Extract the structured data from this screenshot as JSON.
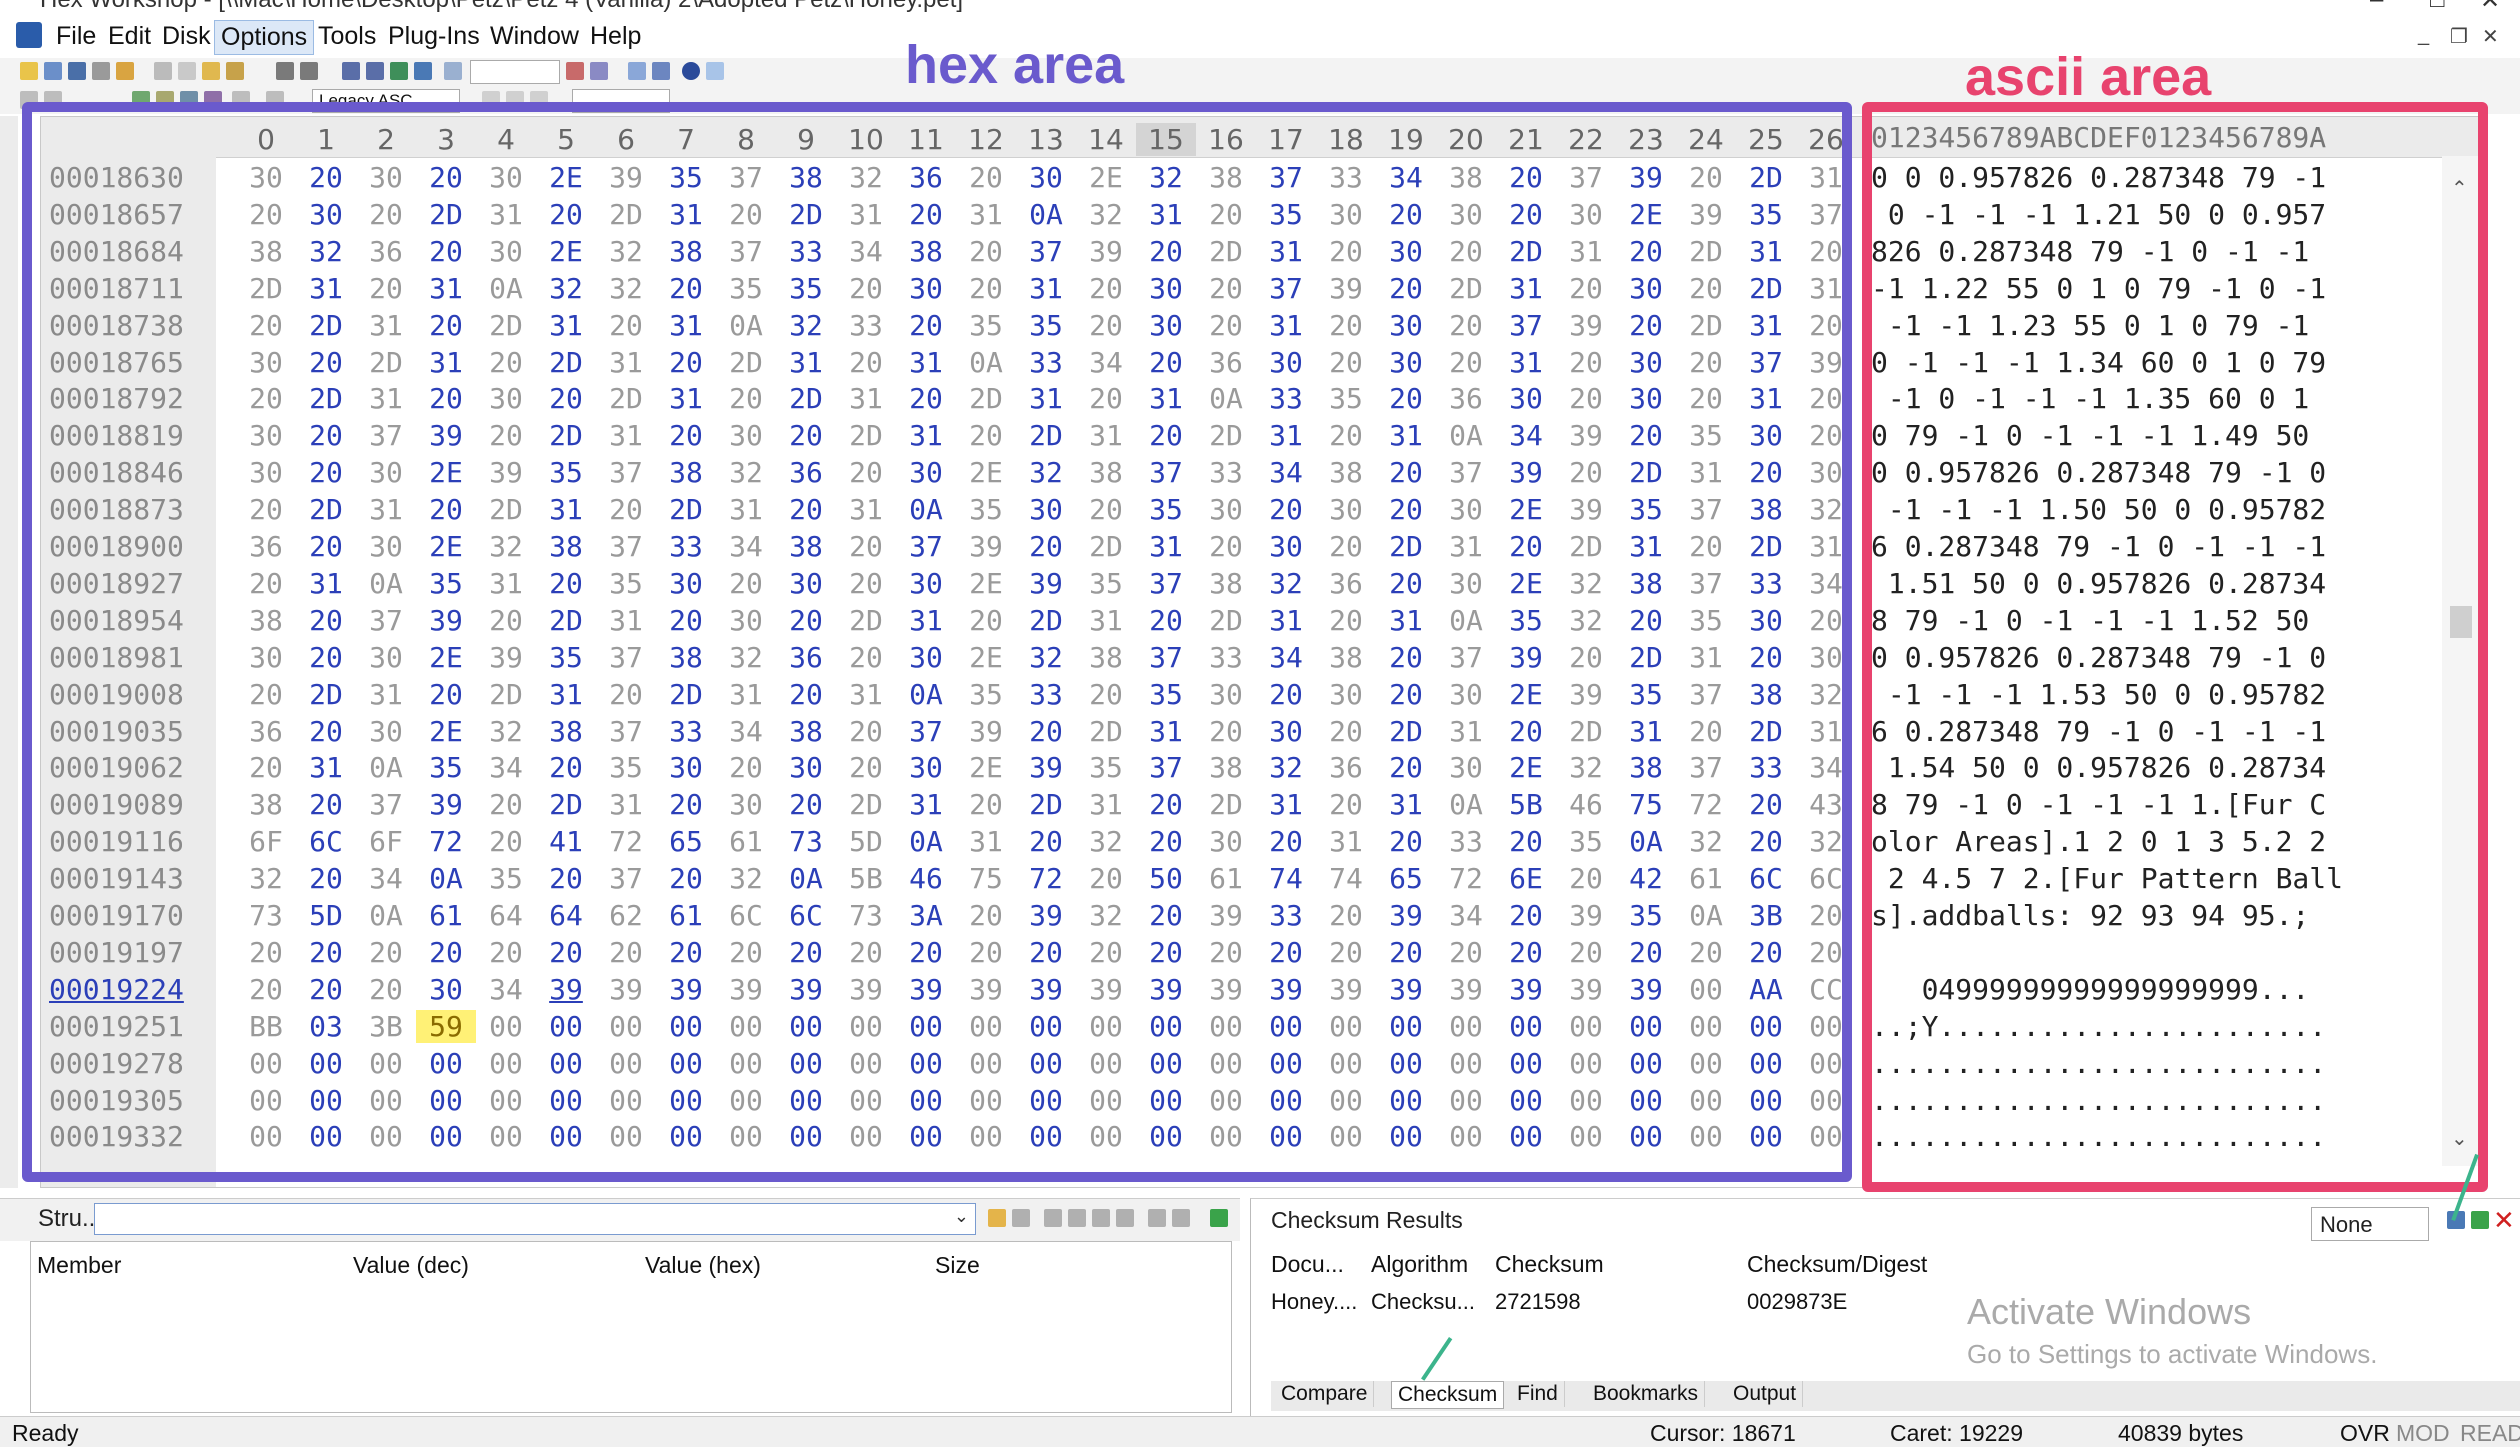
{
  "window": {
    "title": "Hex Workshop - [\\\\Mac\\Home\\Desktop\\Petz\\Petz 4 (Vanilla) 2\\Adopted Petz\\Honey.pet]"
  },
  "menu": [
    "File",
    "Edit",
    "Disk",
    "Options",
    "Tools",
    "Plug-Ins",
    "Window",
    "Help"
  ],
  "toolbar": {
    "view_select": "Legacy ASC"
  },
  "annotations": {
    "hex_label": "hex area",
    "ascii_label": "ascii area"
  },
  "editor": {
    "columns": [
      "0",
      "1",
      "2",
      "3",
      "4",
      "5",
      "6",
      "7",
      "8",
      "9",
      "10",
      "11",
      "12",
      "13",
      "14",
      "15",
      "16",
      "17",
      "18",
      "19",
      "20",
      "21",
      "22",
      "23",
      "24",
      "25",
      "26"
    ],
    "ascii_header": "0123456789ABCDEF0123456789A",
    "rows": [
      {
        "addr": "00018630",
        "hex": [
          "30",
          "20",
          "30",
          "20",
          "30",
          "2E",
          "39",
          "35",
          "37",
          "38",
          "32",
          "36",
          "20",
          "30",
          "2E",
          "32",
          "38",
          "37",
          "33",
          "34",
          "38",
          "20",
          "37",
          "39",
          "20",
          "2D",
          "31"
        ],
        "ascii": "0 0 0.957826 0.287348 79 -1"
      },
      {
        "addr": "00018657",
        "hex": [
          "20",
          "30",
          "20",
          "2D",
          "31",
          "20",
          "2D",
          "31",
          "20",
          "2D",
          "31",
          "20",
          "31",
          "0A",
          "32",
          "31",
          "20",
          "35",
          "30",
          "20",
          "30",
          "20",
          "30",
          "2E",
          "39",
          "35",
          "37"
        ],
        "ascii": " 0 -1 -1 -1 1.21 50 0 0.957"
      },
      {
        "addr": "00018684",
        "hex": [
          "38",
          "32",
          "36",
          "20",
          "30",
          "2E",
          "32",
          "38",
          "37",
          "33",
          "34",
          "38",
          "20",
          "37",
          "39",
          "20",
          "2D",
          "31",
          "20",
          "30",
          "20",
          "2D",
          "31",
          "20",
          "2D",
          "31",
          "20"
        ],
        "ascii": "826 0.287348 79 -1 0 -1 -1 "
      },
      {
        "addr": "00018711",
        "hex": [
          "2D",
          "31",
          "20",
          "31",
          "0A",
          "32",
          "32",
          "20",
          "35",
          "35",
          "20",
          "30",
          "20",
          "31",
          "20",
          "30",
          "20",
          "37",
          "39",
          "20",
          "2D",
          "31",
          "20",
          "30",
          "20",
          "2D",
          "31"
        ],
        "ascii": "-1 1.22 55 0 1 0 79 -1 0 -1"
      },
      {
        "addr": "00018738",
        "hex": [
          "20",
          "2D",
          "31",
          "20",
          "2D",
          "31",
          "20",
          "31",
          "0A",
          "32",
          "33",
          "20",
          "35",
          "35",
          "20",
          "30",
          "20",
          "31",
          "20",
          "30",
          "20",
          "37",
          "39",
          "20",
          "2D",
          "31",
          "20"
        ],
        "ascii": " -1 -1 1.23 55 0 1 0 79 -1 "
      },
      {
        "addr": "00018765",
        "hex": [
          "30",
          "20",
          "2D",
          "31",
          "20",
          "2D",
          "31",
          "20",
          "2D",
          "31",
          "20",
          "31",
          "0A",
          "33",
          "34",
          "20",
          "36",
          "30",
          "20",
          "30",
          "20",
          "31",
          "20",
          "30",
          "20",
          "37",
          "39"
        ],
        "ascii": "0 -1 -1 -1 1.34 60 0 1 0 79"
      },
      {
        "addr": "00018792",
        "hex": [
          "20",
          "2D",
          "31",
          "20",
          "30",
          "20",
          "2D",
          "31",
          "20",
          "2D",
          "31",
          "20",
          "2D",
          "31",
          "20",
          "31",
          "0A",
          "33",
          "35",
          "20",
          "36",
          "30",
          "20",
          "30",
          "20",
          "31",
          "20"
        ],
        "ascii": " -1 0 -1 -1 -1 1.35 60 0 1 "
      },
      {
        "addr": "00018819",
        "hex": [
          "30",
          "20",
          "37",
          "39",
          "20",
          "2D",
          "31",
          "20",
          "30",
          "20",
          "2D",
          "31",
          "20",
          "2D",
          "31",
          "20",
          "2D",
          "31",
          "20",
          "31",
          "0A",
          "34",
          "39",
          "20",
          "35",
          "30",
          "20"
        ],
        "ascii": "0 79 -1 0 -1 -1 -1 1.49 50 "
      },
      {
        "addr": "00018846",
        "hex": [
          "30",
          "20",
          "30",
          "2E",
          "39",
          "35",
          "37",
          "38",
          "32",
          "36",
          "20",
          "30",
          "2E",
          "32",
          "38",
          "37",
          "33",
          "34",
          "38",
          "20",
          "37",
          "39",
          "20",
          "2D",
          "31",
          "20",
          "30"
        ],
        "ascii": "0 0.957826 0.287348 79 -1 0"
      },
      {
        "addr": "00018873",
        "hex": [
          "20",
          "2D",
          "31",
          "20",
          "2D",
          "31",
          "20",
          "2D",
          "31",
          "20",
          "31",
          "0A",
          "35",
          "30",
          "20",
          "35",
          "30",
          "20",
          "30",
          "20",
          "30",
          "2E",
          "39",
          "35",
          "37",
          "38",
          "32"
        ],
        "ascii": " -1 -1 -1 1.50 50 0 0.95782"
      },
      {
        "addr": "00018900",
        "hex": [
          "36",
          "20",
          "30",
          "2E",
          "32",
          "38",
          "37",
          "33",
          "34",
          "38",
          "20",
          "37",
          "39",
          "20",
          "2D",
          "31",
          "20",
          "30",
          "20",
          "2D",
          "31",
          "20",
          "2D",
          "31",
          "20",
          "2D",
          "31"
        ],
        "ascii": "6 0.287348 79 -1 0 -1 -1 -1"
      },
      {
        "addr": "00018927",
        "hex": [
          "20",
          "31",
          "0A",
          "35",
          "31",
          "20",
          "35",
          "30",
          "20",
          "30",
          "20",
          "30",
          "2E",
          "39",
          "35",
          "37",
          "38",
          "32",
          "36",
          "20",
          "30",
          "2E",
          "32",
          "38",
          "37",
          "33",
          "34"
        ],
        "ascii": " 1.51 50 0 0.957826 0.28734"
      },
      {
        "addr": "00018954",
        "hex": [
          "38",
          "20",
          "37",
          "39",
          "20",
          "2D",
          "31",
          "20",
          "30",
          "20",
          "2D",
          "31",
          "20",
          "2D",
          "31",
          "20",
          "2D",
          "31",
          "20",
          "31",
          "0A",
          "35",
          "32",
          "20",
          "35",
          "30",
          "20"
        ],
        "ascii": "8 79 -1 0 -1 -1 -1 1.52 50 "
      },
      {
        "addr": "00018981",
        "hex": [
          "30",
          "20",
          "30",
          "2E",
          "39",
          "35",
          "37",
          "38",
          "32",
          "36",
          "20",
          "30",
          "2E",
          "32",
          "38",
          "37",
          "33",
          "34",
          "38",
          "20",
          "37",
          "39",
          "20",
          "2D",
          "31",
          "20",
          "30"
        ],
        "ascii": "0 0.957826 0.287348 79 -1 0"
      },
      {
        "addr": "00019008",
        "hex": [
          "20",
          "2D",
          "31",
          "20",
          "2D",
          "31",
          "20",
          "2D",
          "31",
          "20",
          "31",
          "0A",
          "35",
          "33",
          "20",
          "35",
          "30",
          "20",
          "30",
          "20",
          "30",
          "2E",
          "39",
          "35",
          "37",
          "38",
          "32"
        ],
        "ascii": " -1 -1 -1 1.53 50 0 0.95782"
      },
      {
        "addr": "00019035",
        "hex": [
          "36",
          "20",
          "30",
          "2E",
          "32",
          "38",
          "37",
          "33",
          "34",
          "38",
          "20",
          "37",
          "39",
          "20",
          "2D",
          "31",
          "20",
          "30",
          "20",
          "2D",
          "31",
          "20",
          "2D",
          "31",
          "20",
          "2D",
          "31"
        ],
        "ascii": "6 0.287348 79 -1 0 -1 -1 -1"
      },
      {
        "addr": "00019062",
        "hex": [
          "20",
          "31",
          "0A",
          "35",
          "34",
          "20",
          "35",
          "30",
          "20",
          "30",
          "20",
          "30",
          "2E",
          "39",
          "35",
          "37",
          "38",
          "32",
          "36",
          "20",
          "30",
          "2E",
          "32",
          "38",
          "37",
          "33",
          "34"
        ],
        "ascii": " 1.54 50 0 0.957826 0.28734"
      },
      {
        "addr": "00019089",
        "hex": [
          "38",
          "20",
          "37",
          "39",
          "20",
          "2D",
          "31",
          "20",
          "30",
          "20",
          "2D",
          "31",
          "20",
          "2D",
          "31",
          "20",
          "2D",
          "31",
          "20",
          "31",
          "0A",
          "5B",
          "46",
          "75",
          "72",
          "20",
          "43"
        ],
        "ascii": "8 79 -1 0 -1 -1 -1 1.[Fur C"
      },
      {
        "addr": "00019116",
        "hex": [
          "6F",
          "6C",
          "6F",
          "72",
          "20",
          "41",
          "72",
          "65",
          "61",
          "73",
          "5D",
          "0A",
          "31",
          "20",
          "32",
          "20",
          "30",
          "20",
          "31",
          "20",
          "33",
          "20",
          "35",
          "0A",
          "32",
          "20",
          "32"
        ],
        "ascii": "olor Areas].1 2 0 1 3 5.2 2"
      },
      {
        "addr": "00019143",
        "hex": [
          "32",
          "20",
          "34",
          "0A",
          "35",
          "20",
          "37",
          "20",
          "32",
          "0A",
          "5B",
          "46",
          "75",
          "72",
          "20",
          "50",
          "61",
          "74",
          "74",
          "65",
          "72",
          "6E",
          "20",
          "42",
          "61",
          "6C",
          "6C"
        ],
        "ascii": " 2 4.5 7 2.[Fur Pattern Ball"
      },
      {
        "addr": "00019170",
        "hex": [
          "73",
          "5D",
          "0A",
          "61",
          "64",
          "64",
          "62",
          "61",
          "6C",
          "6C",
          "73",
          "3A",
          "20",
          "39",
          "32",
          "20",
          "39",
          "33",
          "20",
          "39",
          "34",
          "20",
          "39",
          "35",
          "0A",
          "3B",
          "20"
        ],
        "ascii": "s].addballs: 92 93 94 95.;"
      },
      {
        "addr": "00019197",
        "hex": [
          "20",
          "20",
          "20",
          "20",
          "20",
          "20",
          "20",
          "20",
          "20",
          "20",
          "20",
          "20",
          "20",
          "20",
          "20",
          "20",
          "20",
          "20",
          "20",
          "20",
          "20",
          "20",
          "20",
          "20",
          "20",
          "20",
          "20"
        ],
        "ascii": ""
      },
      {
        "addr": "00019224",
        "hex": [
          "20",
          "20",
          "20",
          "30",
          "34",
          "39",
          "39",
          "39",
          "39",
          "39",
          "39",
          "39",
          "39",
          "39",
          "39",
          "39",
          "39",
          "39",
          "39",
          "39",
          "39",
          "39",
          "39",
          "39",
          "00",
          "AA",
          "CC"
        ],
        "ascii": "   04999999999999999999..."
      },
      {
        "addr": "00019251",
        "hex": [
          "BB",
          "03",
          "3B",
          "59",
          "00",
          "00",
          "00",
          "00",
          "00",
          "00",
          "00",
          "00",
          "00",
          "00",
          "00",
          "00",
          "00",
          "00",
          "00",
          "00",
          "00",
          "00",
          "00",
          "00",
          "00",
          "00",
          "00"
        ],
        "ascii": "..;Y......................."
      },
      {
        "addr": "00019278",
        "hex": [
          "00",
          "00",
          "00",
          "00",
          "00",
          "00",
          "00",
          "00",
          "00",
          "00",
          "00",
          "00",
          "00",
          "00",
          "00",
          "00",
          "00",
          "00",
          "00",
          "00",
          "00",
          "00",
          "00",
          "00",
          "00",
          "00",
          "00"
        ],
        "ascii": "..........................."
      },
      {
        "addr": "00019305",
        "hex": [
          "00",
          "00",
          "00",
          "00",
          "00",
          "00",
          "00",
          "00",
          "00",
          "00",
          "00",
          "00",
          "00",
          "00",
          "00",
          "00",
          "00",
          "00",
          "00",
          "00",
          "00",
          "00",
          "00",
          "00",
          "00",
          "00",
          "00"
        ],
        "ascii": "..........................."
      },
      {
        "addr": "00019332",
        "hex": [
          "00",
          "00",
          "00",
          "00",
          "00",
          "00",
          "00",
          "00",
          "00",
          "00",
          "00",
          "00",
          "00",
          "00",
          "00",
          "00",
          "00",
          "00",
          "00",
          "00",
          "00",
          "00",
          "00",
          "00",
          "00",
          "00",
          "00"
        ],
        "ascii": "..........................."
      }
    ]
  },
  "structure_panel": {
    "label": "Stru...",
    "columns": [
      "Member",
      "Value (dec)",
      "Value (hex)",
      "Size"
    ]
  },
  "checksum_panel": {
    "title": "Checksum Results",
    "select_value": "None",
    "columns": [
      "Docu...",
      "Algorithm",
      "Checksum",
      "Checksum/Digest"
    ],
    "row": [
      "Honey....",
      "Checksu...",
      "2721598",
      "0029873E"
    ],
    "watermark_title": "Activate Windows",
    "watermark_sub": "Go to Settings to activate Windows.",
    "tabs": [
      "Compare",
      "Checksum",
      "Find",
      "Bookmarks",
      "Output"
    ]
  },
  "status": {
    "ready": "Ready",
    "cursor": "Cursor: 18671",
    "caret": "Caret: 19229",
    "size": "40839 bytes",
    "ovr": "OVR",
    "mod": "MOD",
    "read": "READ"
  },
  "colors": {
    "hex_box": "#6a5acd",
    "ascii_box": "#e8436e",
    "accent_blue": "#2b3fb8",
    "selection": "#fff176"
  }
}
